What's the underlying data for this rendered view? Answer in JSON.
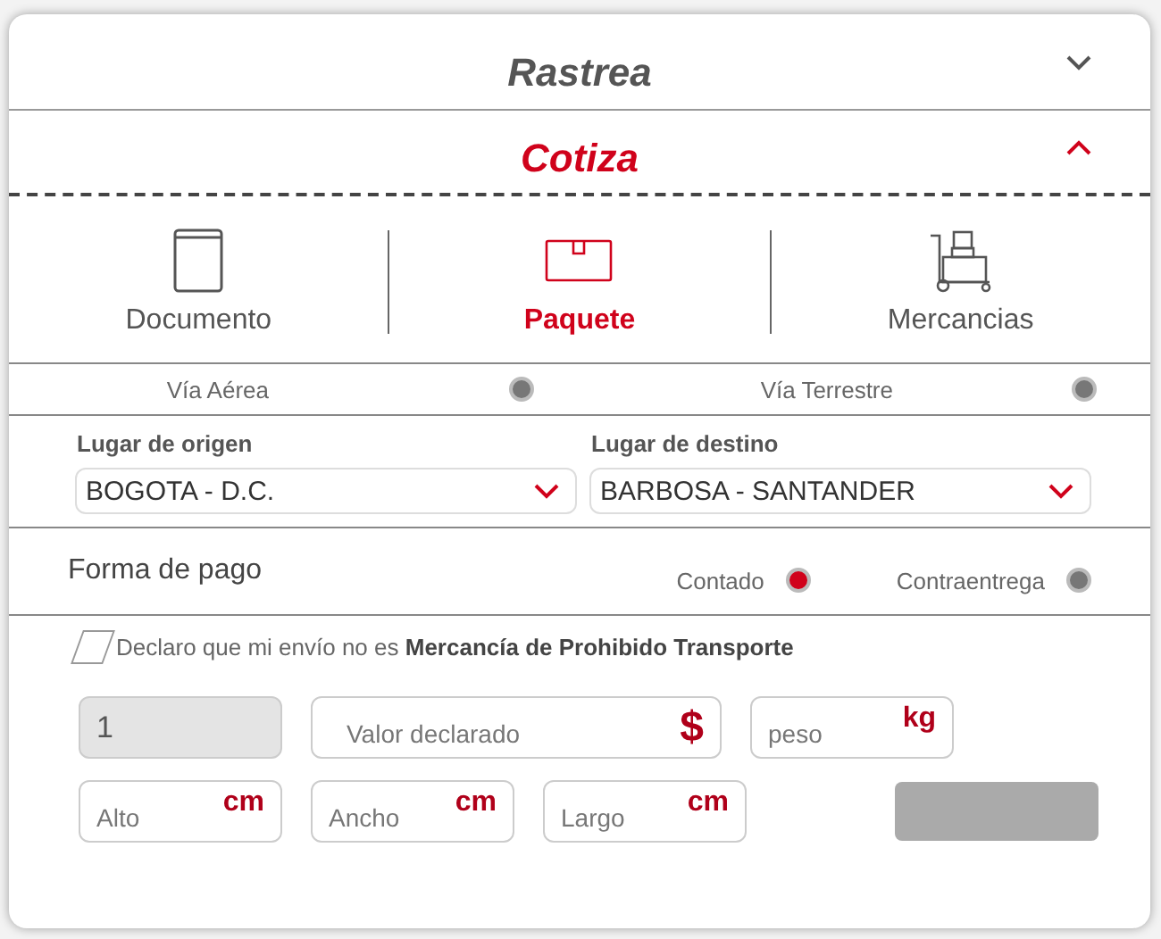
{
  "sections": [
    {
      "title": "Rastrea",
      "expanded": false
    },
    {
      "title": "Cotiza",
      "expanded": true
    }
  ],
  "service_types": [
    {
      "label": "Documento",
      "kind": "document",
      "selected": false
    },
    {
      "label": "Paquete",
      "kind": "package",
      "selected": true
    },
    {
      "label": "Mercancias",
      "kind": "cargo",
      "selected": false
    }
  ],
  "transport_modes": [
    {
      "label": "Vía Aérea",
      "selected": false
    },
    {
      "label": "Vía Terrestre",
      "selected": false
    }
  ],
  "origin": {
    "label": "Lugar de origen",
    "value": "BOGOTA - D.C."
  },
  "destination": {
    "label": "Lugar de destino",
    "value": "BARBOSA - SANTANDER"
  },
  "payment": {
    "label": "Forma de pago",
    "options": [
      {
        "label": "Contado",
        "selected": true
      },
      {
        "label": "Contraentrega",
        "selected": false
      }
    ]
  },
  "declaration": {
    "text": "Declaro que mi envío no es **Mercancía de Prohibido Transporte**",
    "checked": false
  },
  "fields_row_1": [
    {
      "kind": "quantity",
      "value": "1",
      "disabled": true
    },
    {
      "kind": "field",
      "placeholder": "Valor declarado",
      "unit": "$"
    },
    {
      "kind": "field",
      "placeholder": "peso",
      "unit": "kg"
    }
  ],
  "fields_row_2": [
    {
      "kind": "field",
      "placeholder": "Alto",
      "unit": "cm"
    },
    {
      "kind": "field",
      "placeholder": "Ancho",
      "unit": "cm"
    },
    {
      "kind": "field",
      "placeholder": "Largo",
      "unit": "cm"
    }
  ],
  "submit": {
    "disabled": true
  }
}
